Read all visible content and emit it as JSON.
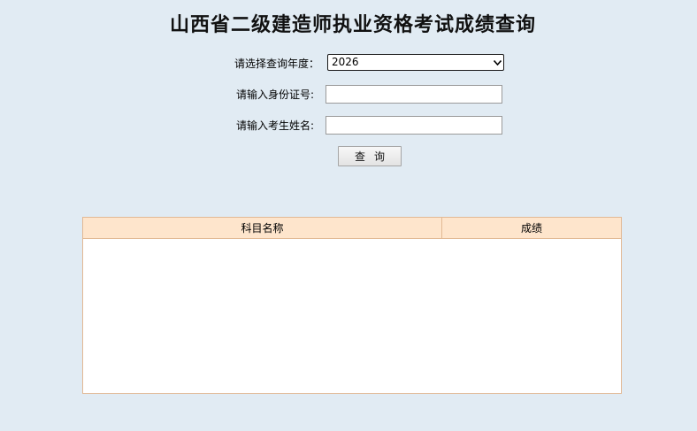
{
  "page": {
    "title": "山西省二级建造师执业资格考试成绩查询"
  },
  "form": {
    "year_label": "请选择查询年度：",
    "year_value": "2026",
    "id_label": "请输入身份证号:",
    "id_value": "",
    "name_label": "请输入考生姓名:",
    "name_value": "",
    "submit_label": "查询"
  },
  "results": {
    "columns": [
      "科目名称",
      "成绩"
    ],
    "rows": []
  },
  "colors": {
    "background": "#e1ebf3",
    "table_header": "#fee5cc",
    "table_border": "#e2b994"
  }
}
